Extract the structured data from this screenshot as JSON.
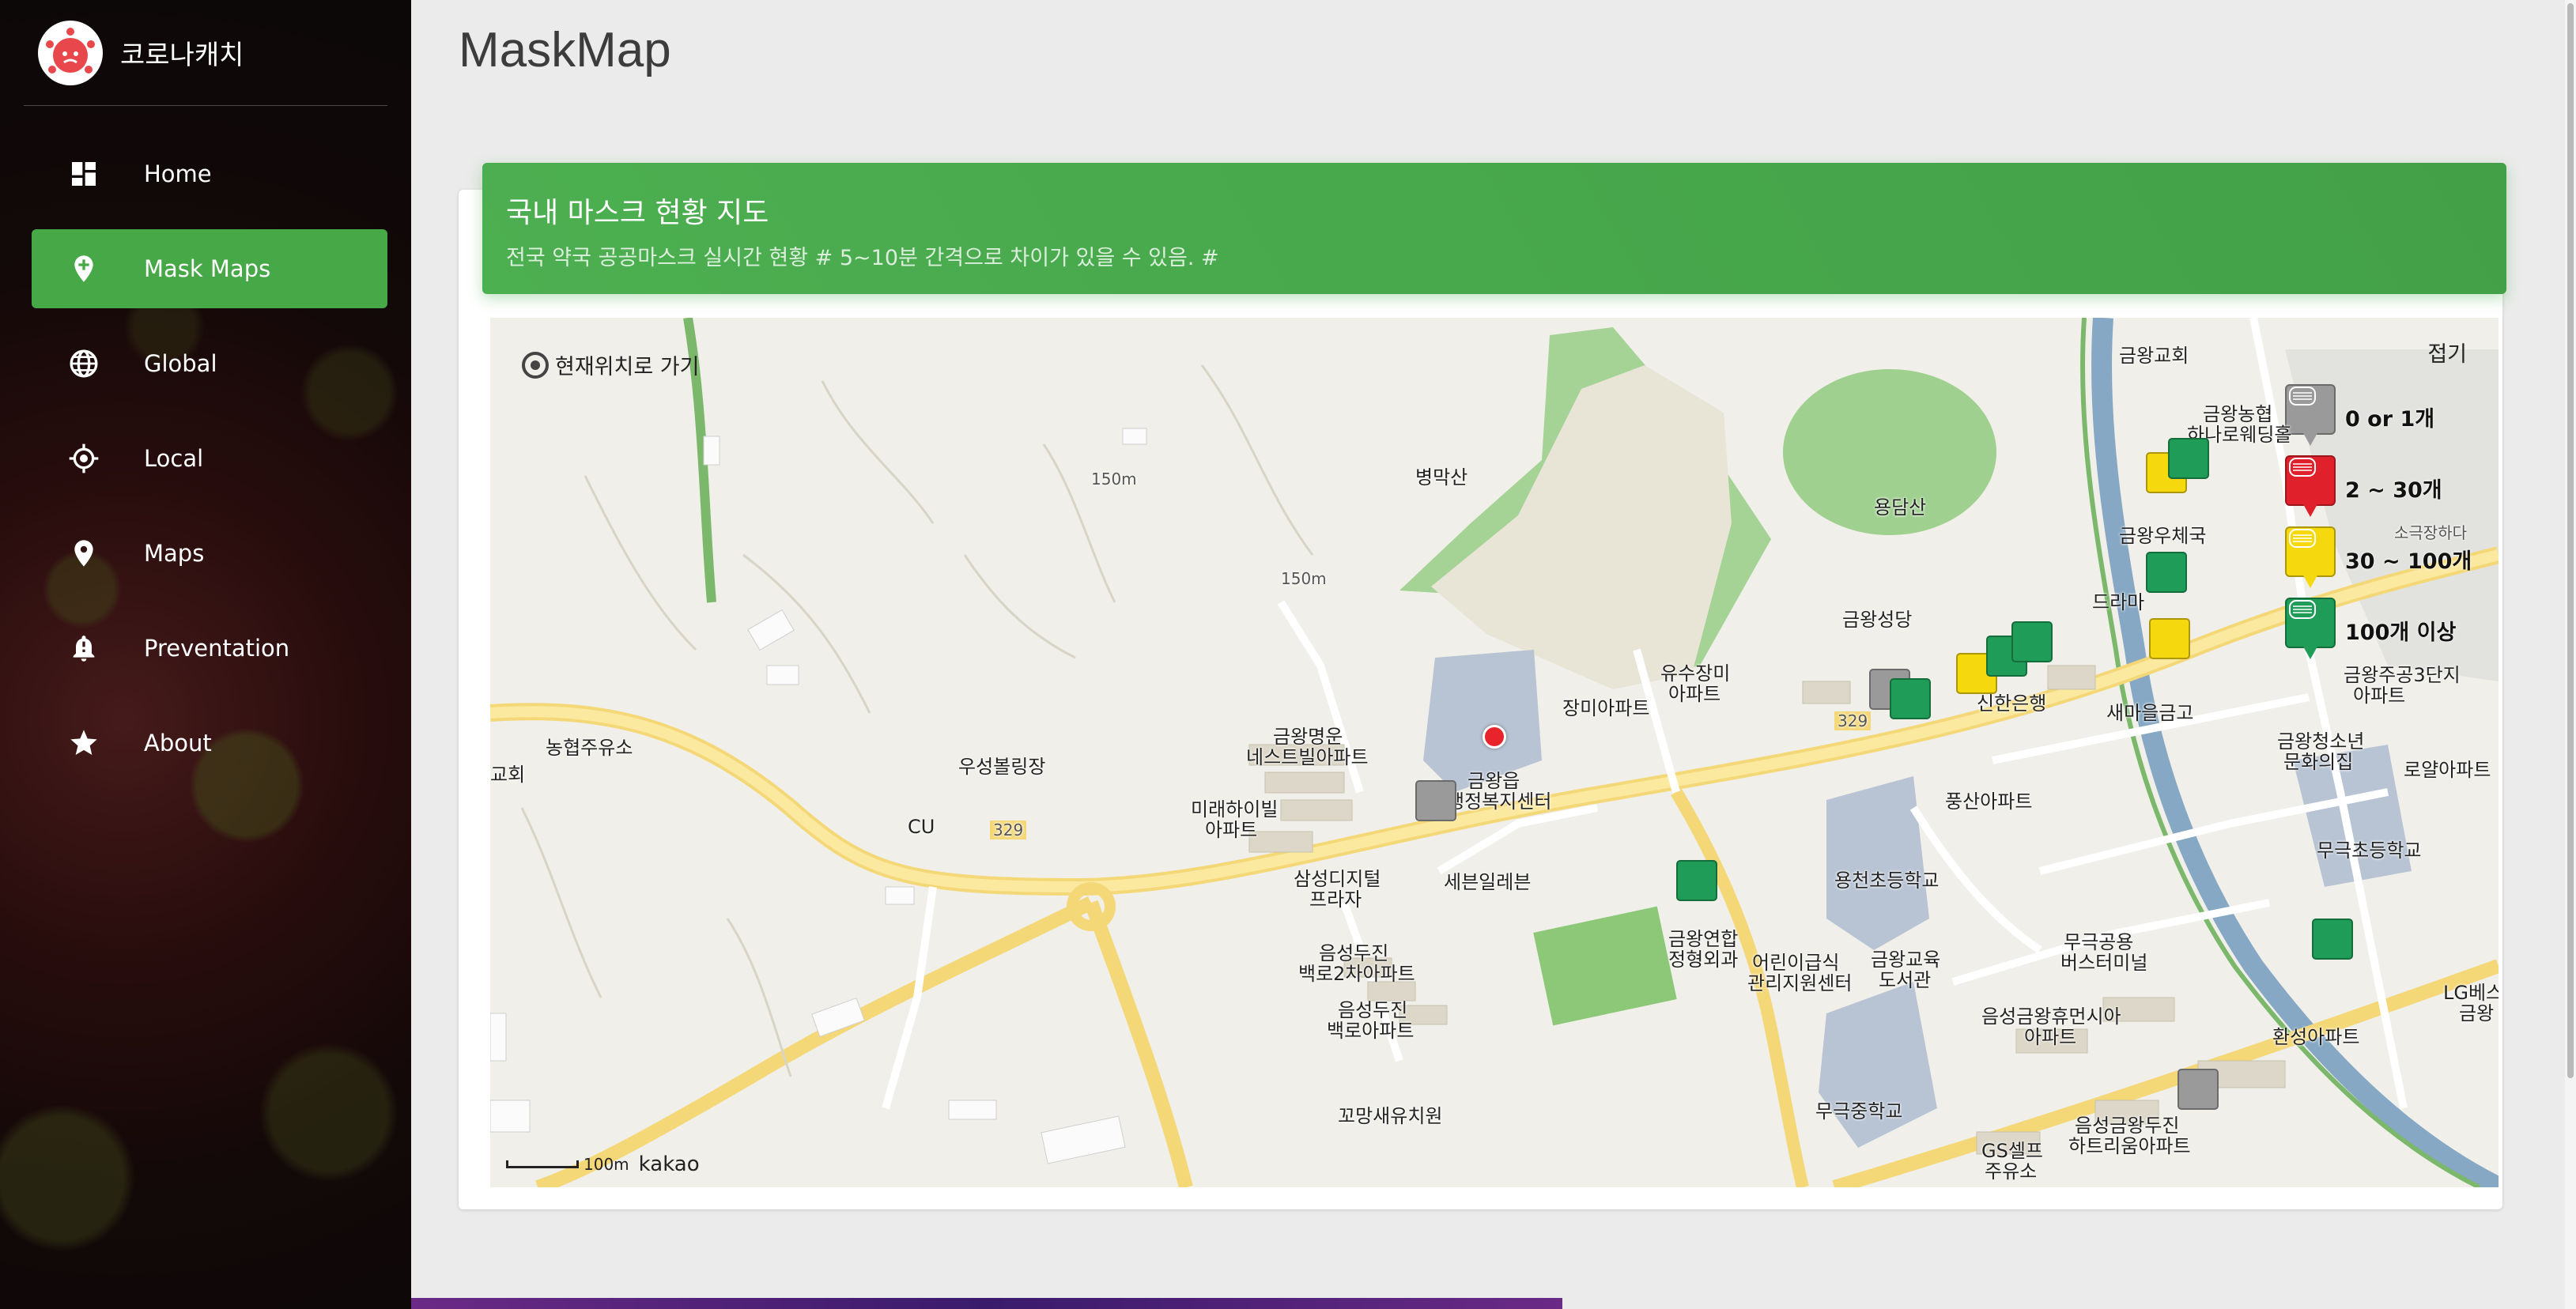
{
  "app": {
    "name": "코로나캐치",
    "page_title": "MaskMap"
  },
  "sidebar": {
    "items": [
      {
        "label": "Home",
        "icon": "dashboard-icon"
      },
      {
        "label": "Mask Maps",
        "icon": "add-location-icon",
        "active": true
      },
      {
        "label": "Global",
        "icon": "globe-icon"
      },
      {
        "label": "Local",
        "icon": "gps-target-icon"
      },
      {
        "label": "Maps",
        "icon": "location-pin-icon"
      },
      {
        "label": "Preventation",
        "icon": "alert-bell-icon"
      },
      {
        "label": "About",
        "icon": "star-icon"
      }
    ]
  },
  "card": {
    "title": "국내 마스크 현황 지도",
    "subtitle": "전국 약국 공공마스크 실시간 현황 # 5~10분 간격으로 차이가 있을 수 있음. #"
  },
  "map": {
    "locate_label": "현재위치로 가기",
    "collapse_label": "접기",
    "scale_label": "100m",
    "provider": "kakao",
    "legend": [
      {
        "label": "0 or 1개",
        "color": "#9a9a9a",
        "tag": "1 OR 0"
      },
      {
        "label": "2 ~ 30개",
        "color": "#e0202a",
        "tag": "2 ~ 30"
      },
      {
        "label": "30 ~ 100개",
        "color": "#f5d90e",
        "tag": "30 ~ 100"
      },
      {
        "label": "100개 이상",
        "color": "#1f9c57",
        "tag": "100 ~"
      }
    ],
    "places": {
      "p1": "병막산",
      "p2": "150m",
      "p3": "150m",
      "p4": "용담산",
      "p5": "금왕교회",
      "p6": "금왕농협",
      "p7": "하나로웨딩홀",
      "p8": "금왕우체국",
      "p9": "드라마",
      "p10": "금왕성당",
      "p11": "유수장미",
      "p12": "아파트",
      "p13": "장미아파트",
      "p14": "신한은행",
      "p15": "새마을금고",
      "p16": "금왕청소년",
      "p17": "문화의집",
      "p18": "로얄아파트",
      "p19": "금왕명운",
      "p20": "네스트빌아파트",
      "p21": "금왕읍",
      "p22": "행정복지센터",
      "p23": "우성볼링장",
      "p24": "농협주유소",
      "p25": "교회",
      "p26": "CU",
      "p27": "미래하이빌",
      "p28": "아파트",
      "p29": "삼성디지털",
      "p30": "프라자",
      "p31": "세븐일레븐",
      "p32": "풍산아파트",
      "p33": "용천초등학교",
      "p34": "금왕연합",
      "p35": "정형외과",
      "p36": "어린이급식",
      "p37": "관리지원센터",
      "p38": "금왕교육",
      "p39": "도서관",
      "p40": "무극공용",
      "p41": "버스터미널",
      "p42": "무극초등학교",
      "p43": "음성두진",
      "p44": "백로2차아파트",
      "p45": "음성두진",
      "p46": "백로아파트",
      "p47": "꼬망새유치원",
      "p48": "음성금왕휴먼시아",
      "p49": "아파트",
      "p50": "환성아파트",
      "p51": "LG베스",
      "p52": "금왕",
      "p53": "무극중학교",
      "p54": "GS셀프",
      "p55": "주유소",
      "p56": "음성금왕두진",
      "p57": "하트리움아파트",
      "p58": "금왕주공3단지",
      "p59": "아파트",
      "p60": "소극장하다",
      "p61": "329",
      "p62": "329"
    }
  }
}
